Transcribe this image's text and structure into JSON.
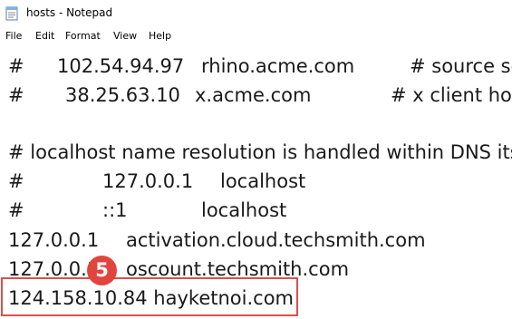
{
  "window": {
    "title": "hosts - Notepad",
    "icon": "notepad-icon"
  },
  "menu": {
    "file": "File",
    "edit": "Edit",
    "format": "Format",
    "view": "View",
    "help": "Help"
  },
  "lines": {
    "l1": {
      "hash": "#",
      "ip": "102.54.94.97",
      "host": "rhino.acme.com",
      "comment": "# source se"
    },
    "l2": {
      "hash": "#",
      "ip": "38.25.63.10",
      "host": "x.acme.com",
      "comment": "# x client hos"
    },
    "l3": {
      "text": "# localhost name resolution is handled within DNS itself"
    },
    "l4": {
      "hash": "#",
      "ip": "127.0.0.1",
      "host": "localhost"
    },
    "l5": {
      "hash": "#",
      "ip": "::1",
      "host": "localhost"
    },
    "l6": {
      "ip": "127.0.0.1",
      "host": "activation.cloud.techsmith.com"
    },
    "l7": {
      "ip": "127.0.0.1",
      "host": "oscount.techsmith.com"
    },
    "l8": {
      "text": "124.158.10.84 hayketnoi.com"
    }
  },
  "annotation": {
    "step_number": "5",
    "color": "#e1453d",
    "box_color": "#d9504a"
  }
}
